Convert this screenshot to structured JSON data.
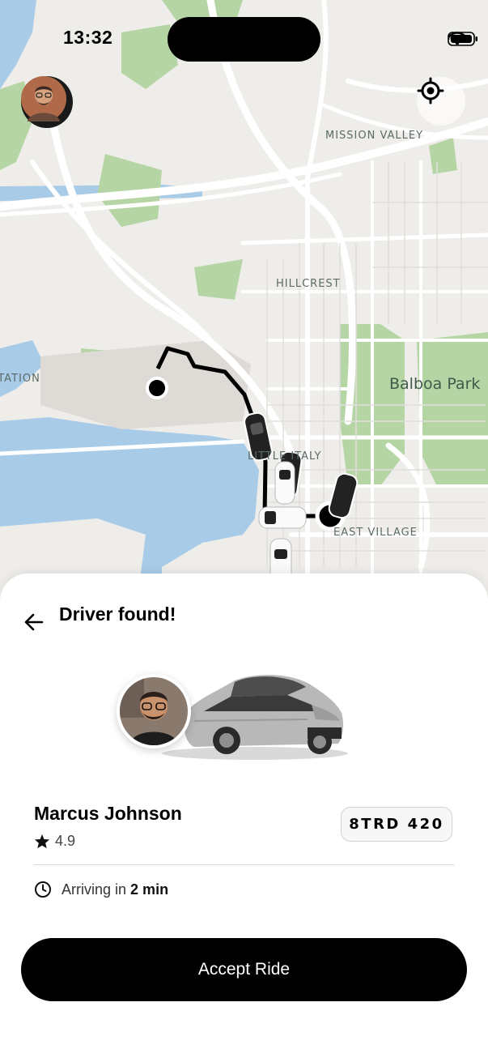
{
  "status_bar": {
    "time": "13:32"
  },
  "map": {
    "labels": {
      "mission_valley": "MISSION VALLEY",
      "hillcrest": "HILLCREST",
      "balboa_park": "Balboa Park",
      "station": "STATION",
      "little_italy": "LITTLE ITALY",
      "east_village": "EAST VILLAGE"
    },
    "colors": {
      "land": "#efedea",
      "water": "#a8cbe8",
      "park": "#b5d6a4",
      "road": "#ffffff",
      "route": "#000000"
    }
  },
  "sheet": {
    "title": "Driver found!",
    "driver": {
      "name": "Marcus Johnson",
      "rating": "4.9"
    },
    "plate": "8TRD 420",
    "eta_prefix": "Arriving in",
    "eta_value": "2 min",
    "accept_label": "Accept Ride"
  },
  "icons": [
    "back-arrow-icon",
    "star-icon",
    "clock-icon",
    "locate-icon",
    "wifi-icon",
    "battery-icon",
    "signal-icon"
  ]
}
